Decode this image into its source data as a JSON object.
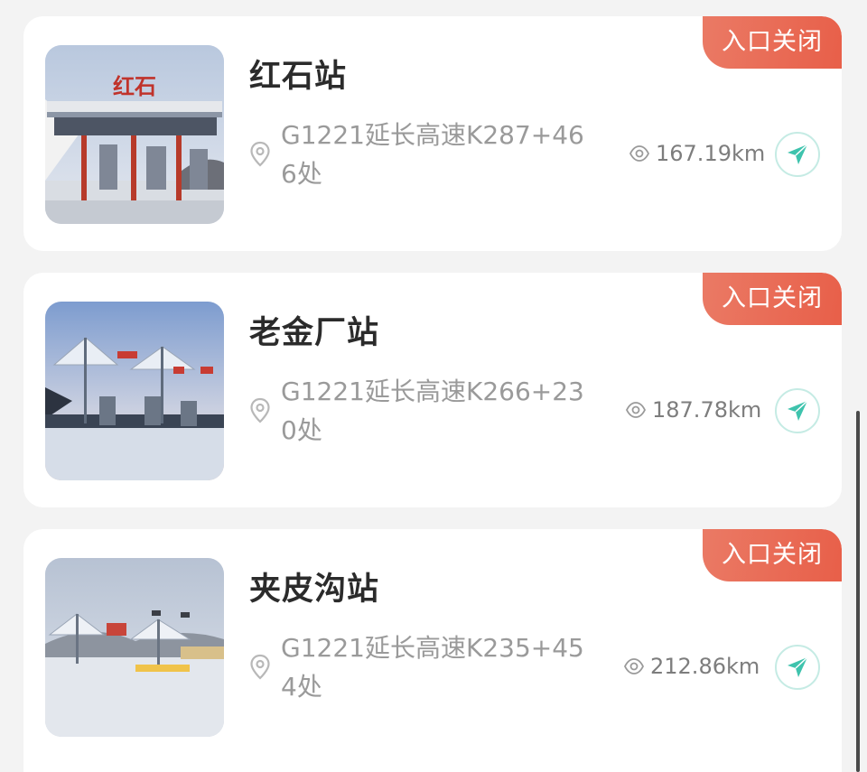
{
  "colors": {
    "badge": "#e85f49",
    "nav_accent": "#3ec3ad",
    "text_primary": "#2b2b2b",
    "text_secondary": "#9a9a9a"
  },
  "stations": [
    {
      "name": "红石站",
      "status": "入口关闭",
      "address": "G1221延长高速K287+466处",
      "distance": "167.19km",
      "sign_text": "红石"
    },
    {
      "name": "老金厂站",
      "status": "入口关闭",
      "address": "G1221延长高速K266+230处",
      "distance": "187.78km"
    },
    {
      "name": "夹皮沟站",
      "status": "入口关闭",
      "address": "G1221延长高速K235+454处",
      "distance": "212.86km"
    }
  ],
  "icons": {
    "location": "location-pin-icon",
    "distance": "eye-distance-icon",
    "navigate": "navigate-arrow-icon"
  }
}
